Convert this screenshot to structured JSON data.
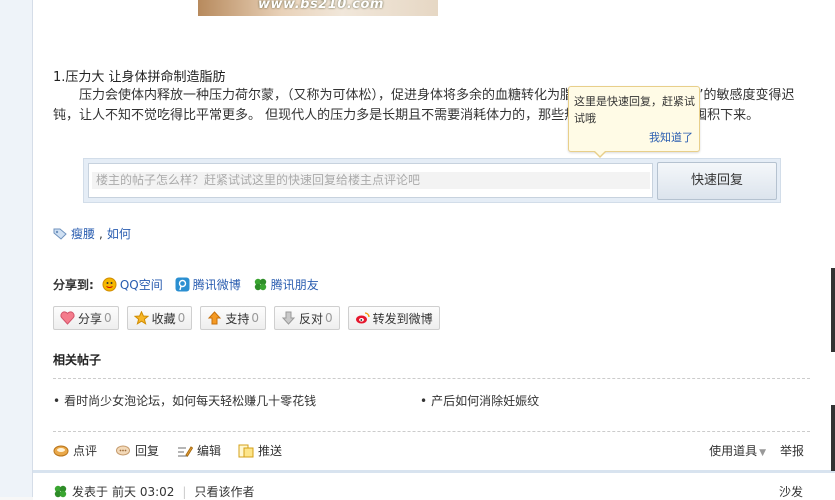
{
  "top_image": {
    "watermark": "www.bs210.com"
  },
  "article": {
    "section_title": "1.压力大 让身体拼命制造脂肪",
    "paragraph": "压力会使体内释放一种压力荷尔蒙，（又称为可体松），促进身体将多余的血糖转化为脂肪，还会使大脑对“饱”的敏感度变得迟钝，让人不知不觉吃得比平常更多。 但现代人的压力多是长期且不需要消耗体力的，那些热量无法被消耗，只好囤积下来。"
  },
  "tooltip": {
    "text": "这里是快速回复，赶紧试试哦",
    "link": "我知道了"
  },
  "quick_reply": {
    "placeholder": "楼主的帖子怎么样？赶紧试试这里的快速回复给楼主点评论吧",
    "button": "快速回复"
  },
  "tags": {
    "items": [
      "瘦腰",
      "如何"
    ],
    "separator": ", "
  },
  "share": {
    "label": "分享到:",
    "items": [
      {
        "label": "QQ空间",
        "icon": "qzone-icon",
        "color": "#f5b800"
      },
      {
        "label": "腾讯微博",
        "icon": "tencent-weibo-icon",
        "color": "#2b8fd1"
      },
      {
        "label": "腾讯朋友",
        "icon": "tencent-friends-icon",
        "color": "#3aa531"
      }
    ]
  },
  "actions": [
    {
      "label": "分享",
      "count": "0",
      "icon": "heart-icon"
    },
    {
      "label": "收藏",
      "count": "0",
      "icon": "star-icon"
    },
    {
      "label": "支持",
      "count": "0",
      "icon": "thumb-up-icon"
    },
    {
      "label": "反对",
      "count": "0",
      "icon": "thumb-down-icon"
    },
    {
      "label": "转发到微博",
      "count": "",
      "icon": "weibo-icon"
    }
  ],
  "related": {
    "title": "相关帖子",
    "items": [
      "看时尚少女泡论坛，如何每天轻松赚几十零花钱",
      "产后如何消除妊娠纹"
    ]
  },
  "post_bar": {
    "comment": "点评",
    "reply": "回复",
    "edit": "编辑",
    "push": "推送",
    "tools": "使用道具",
    "report": "举报"
  },
  "footer": {
    "posted_prefix": "发表于",
    "posted_time": "前天 03:02",
    "author_only": "只看该作者",
    "floor": "沙发"
  }
}
